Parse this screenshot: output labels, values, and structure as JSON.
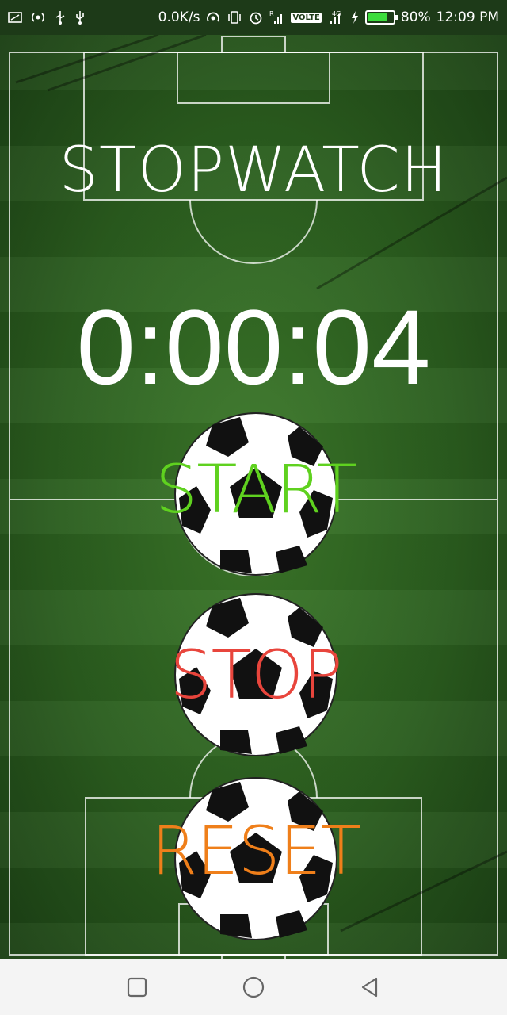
{
  "status_bar": {
    "network_speed": "0.0K/s",
    "signal_tag": "R",
    "volte_label": "VOLTE",
    "network_type": "4G",
    "battery_percent": "80%",
    "battery_level": 0.8,
    "time": "12:09 PM"
  },
  "app": {
    "title": "STOPWATCH",
    "elapsed": "0:00:04"
  },
  "buttons": {
    "start": {
      "label": "START",
      "color": "#5fd11f"
    },
    "stop": {
      "label": "STOP",
      "color": "#e8453c"
    },
    "reset": {
      "label": "RESET",
      "color": "#ef7f1a"
    }
  },
  "nav": {
    "recents_icon": "square-icon",
    "home_icon": "circle-icon",
    "back_icon": "triangle-back-icon"
  }
}
